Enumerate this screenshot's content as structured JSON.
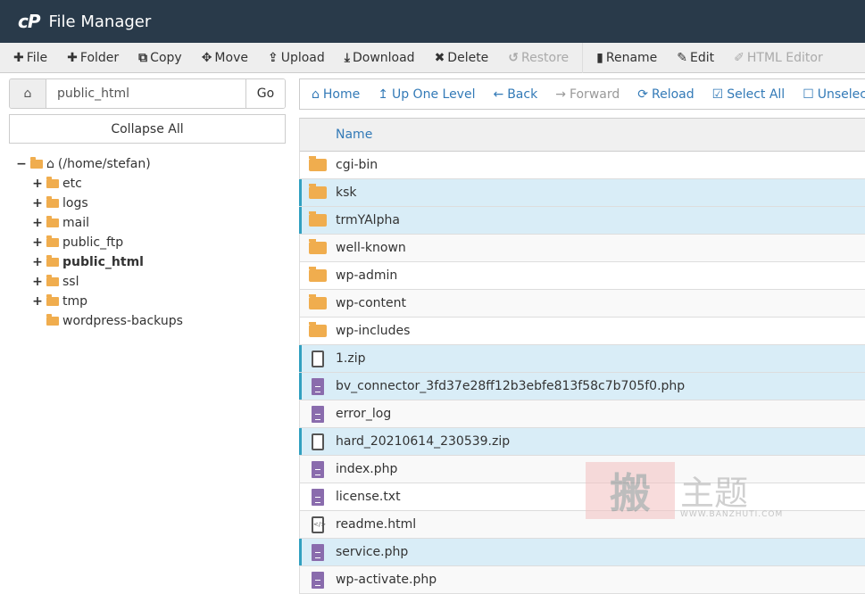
{
  "header": {
    "logo": "cP",
    "title": "File Manager"
  },
  "toolbar": [
    {
      "icon": "plus-icon",
      "glyph": "✚",
      "label": "File",
      "disabled": false
    },
    {
      "icon": "plus-icon",
      "glyph": "✚",
      "label": "Folder",
      "disabled": false
    },
    {
      "icon": "copy-icon",
      "glyph": "⧉",
      "label": "Copy",
      "disabled": false
    },
    {
      "icon": "move-icon",
      "glyph": "✥",
      "label": "Move",
      "disabled": false
    },
    {
      "icon": "upload-icon",
      "glyph": "⇪",
      "label": "Upload",
      "disabled": false
    },
    {
      "icon": "download-icon",
      "glyph": "⤓",
      "label": "Download",
      "disabled": false
    },
    {
      "icon": "delete-icon",
      "glyph": "✖",
      "label": "Delete",
      "disabled": false
    },
    {
      "icon": "restore-icon",
      "glyph": "↺",
      "label": "Restore",
      "disabled": true
    },
    {
      "icon": "rename-icon",
      "glyph": "▮",
      "label": "Rename",
      "disabled": false
    },
    {
      "icon": "edit-icon",
      "glyph": "✎",
      "label": "Edit",
      "disabled": false
    },
    {
      "icon": "html-editor-icon",
      "glyph": "✐",
      "label": "HTML Editor",
      "disabled": true
    }
  ],
  "pathbar": {
    "value": "public_html",
    "go": "Go"
  },
  "collapse_all": "Collapse All",
  "tree": {
    "root": "(/home/stefan)",
    "children": [
      {
        "label": "etc",
        "expandable": true,
        "current": false
      },
      {
        "label": "logs",
        "expandable": true,
        "current": false
      },
      {
        "label": "mail",
        "expandable": true,
        "current": false
      },
      {
        "label": "public_ftp",
        "expandable": true,
        "current": false
      },
      {
        "label": "public_html",
        "expandable": true,
        "current": true
      },
      {
        "label": "ssl",
        "expandable": true,
        "current": false
      },
      {
        "label": "tmp",
        "expandable": true,
        "current": false
      },
      {
        "label": "wordpress-backups",
        "expandable": false,
        "current": false
      }
    ]
  },
  "nav": [
    {
      "icon": "home-icon",
      "glyph": "⌂",
      "label": "Home",
      "disabled": false
    },
    {
      "icon": "up-level-icon",
      "glyph": "↥",
      "label": "Up One Level",
      "disabled": false
    },
    {
      "icon": "back-icon",
      "glyph": "←",
      "label": "Back",
      "disabled": false
    },
    {
      "icon": "forward-icon",
      "glyph": "→",
      "label": "Forward",
      "disabled": true
    },
    {
      "icon": "reload-icon",
      "glyph": "⟳",
      "label": "Reload",
      "disabled": false
    },
    {
      "icon": "select-all-icon",
      "glyph": "☑",
      "label": "Select All",
      "disabled": false
    },
    {
      "icon": "unselect-icon",
      "glyph": "☐",
      "label": "Unselect All",
      "disabled": false
    }
  ],
  "table": {
    "header": "Name",
    "rows": [
      {
        "name": "cgi-bin",
        "type": "folder",
        "selected": false
      },
      {
        "name": "ksk",
        "type": "folder",
        "selected": true
      },
      {
        "name": "trmYAlpha",
        "type": "folder",
        "selected": true
      },
      {
        "name": "well-known",
        "type": "folder",
        "selected": false
      },
      {
        "name": "wp-admin",
        "type": "folder",
        "selected": false
      },
      {
        "name": "wp-content",
        "type": "folder",
        "selected": false
      },
      {
        "name": "wp-includes",
        "type": "folder",
        "selected": false
      },
      {
        "name": "1.zip",
        "type": "zip",
        "selected": true
      },
      {
        "name": "bv_connector_3fd37e28ff12b3ebfe813f58c7b705f0.php",
        "type": "file",
        "selected": true
      },
      {
        "name": "error_log",
        "type": "file",
        "selected": false
      },
      {
        "name": "hard_20210614_230539.zip",
        "type": "zip",
        "selected": true
      },
      {
        "name": "index.php",
        "type": "file",
        "selected": false
      },
      {
        "name": "license.txt",
        "type": "file",
        "selected": false
      },
      {
        "name": "readme.html",
        "type": "html",
        "selected": false
      },
      {
        "name": "service.php",
        "type": "file",
        "selected": true
      },
      {
        "name": "wp-activate.php",
        "type": "file",
        "selected": false
      }
    ]
  },
  "watermark": {
    "seal": "搬",
    "text": "主题",
    "url": "WWW.BANZHUTI.COM"
  }
}
